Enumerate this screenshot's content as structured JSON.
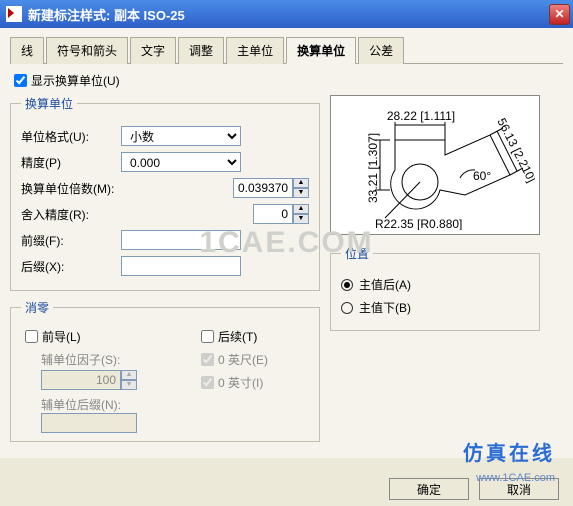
{
  "window": {
    "title": "新建标注样式: 副本 ISO-25"
  },
  "tabs": [
    "线",
    "符号和箭头",
    "文字",
    "调整",
    "主单位",
    "换算单位",
    "公差"
  ],
  "showAlt": {
    "label": "显示换算单位(U)"
  },
  "group_altunits": {
    "legend": "换算单位",
    "format_label": "单位格式(U):",
    "format_value": "小数",
    "precision_label": "精度(P)",
    "precision_value": "0.000",
    "mult_label": "换算单位倍数(M):",
    "mult_value": "0.039370",
    "round_label": "舍入精度(R):",
    "round_value": "0",
    "prefix_label": "前缀(F):",
    "prefix_value": "",
    "suffix_label": "后缀(X):",
    "suffix_value": ""
  },
  "group_suppress": {
    "legend": "消零",
    "leading": "前导(L)",
    "trailing": "后续(T)",
    "subfactor_label": "辅单位因子(S):",
    "subfactor_value": "100",
    "feet": "0 英尺(E)",
    "inches": "0 英寸(I)",
    "subsuffix_label": "辅单位后缀(N):",
    "subsuffix_value": ""
  },
  "group_position": {
    "legend": "位置",
    "after": "主值后(A)",
    "below": "主值下(B)"
  },
  "preview": {
    "dim1": "28.22 [1.111]",
    "dim2": "33.21 [1.307]",
    "dim3": "R22.35 [R0.880]",
    "dim4": "56.13 [2.210]",
    "ang": "60°"
  },
  "buttons": {
    "ok": "确定",
    "cancel": "取消"
  },
  "watermark": {
    "text": "仿真在线",
    "url": "www.1CAE.com",
    "mid": "1CAE.COM"
  }
}
